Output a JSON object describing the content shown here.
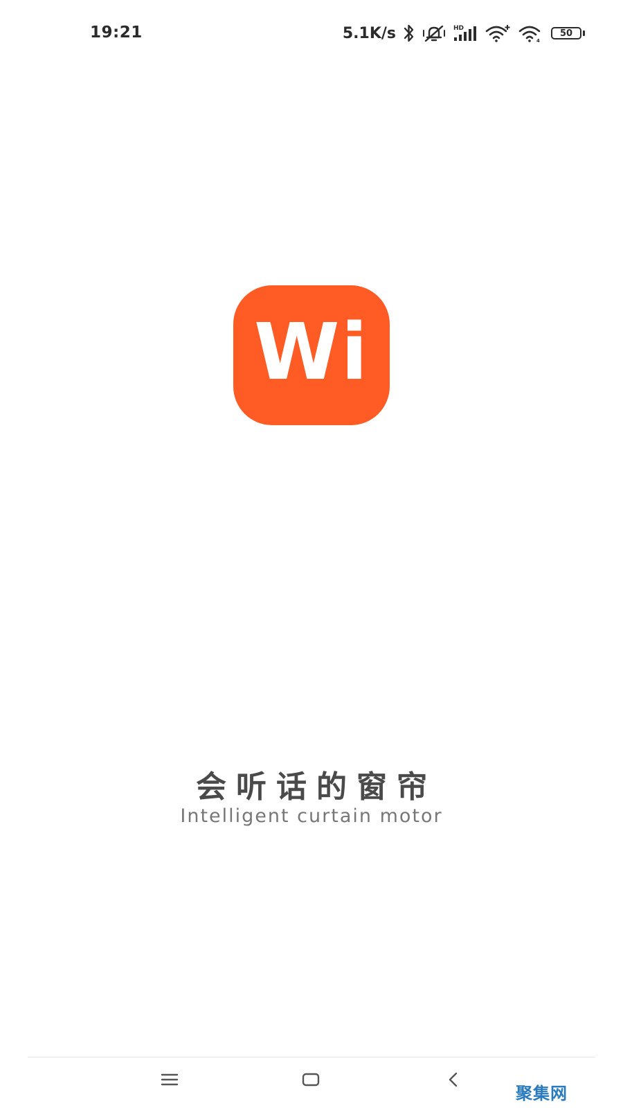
{
  "status_bar": {
    "time": "19:21",
    "net_speed": "5.1K/s",
    "icons": [
      "bluetooth-icon",
      "mute-icon",
      "hd-signal-icon",
      "wifi-plus-icon",
      "wifi-icon",
      "battery-icon"
    ],
    "hd_label": "HD",
    "battery_level": "50"
  },
  "splash": {
    "logo_text": "Wi",
    "logo_color": "#FF5B24",
    "slogan_cn": "会听话的窗帘",
    "slogan_en": "Intelligent curtain motor"
  },
  "nav_bar": {
    "icons": [
      "menu-icon",
      "home-icon",
      "back-icon"
    ]
  },
  "watermark": "聚集网"
}
